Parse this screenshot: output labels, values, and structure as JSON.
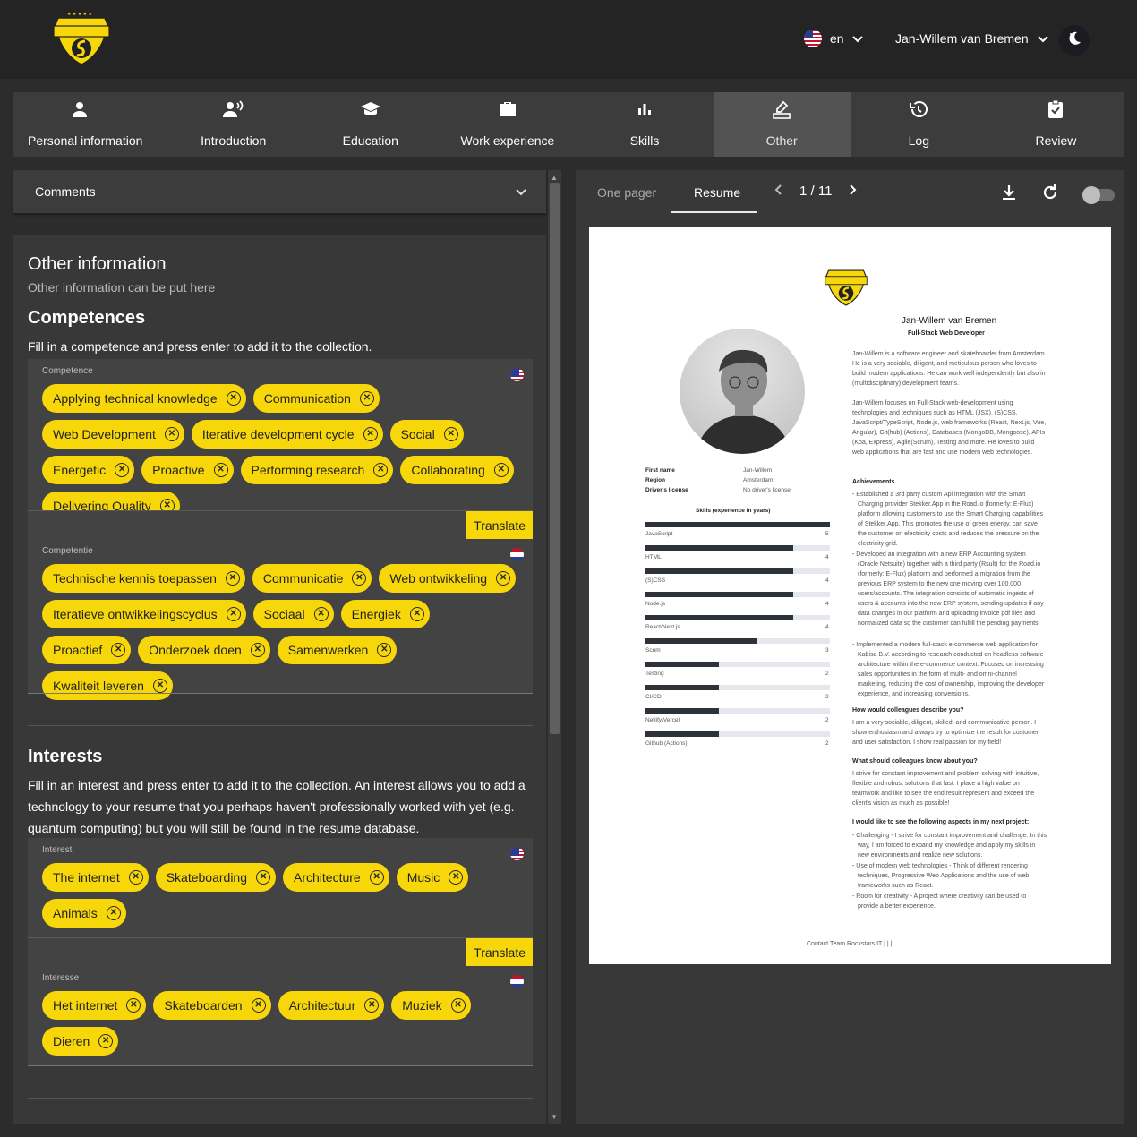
{
  "header": {
    "language": "en",
    "user_name": "Jan-Willem van Bremen"
  },
  "tabs": [
    {
      "label": "Personal information",
      "icon": "person-icon"
    },
    {
      "label": "Introduction",
      "icon": "speaker-icon"
    },
    {
      "label": "Education",
      "icon": "graduation-cap-icon"
    },
    {
      "label": "Work experience",
      "icon": "briefcase-icon"
    },
    {
      "label": "Skills",
      "icon": "bar-chart-icon"
    },
    {
      "label": "Other",
      "icon": "edit-box-icon"
    },
    {
      "label": "Log",
      "icon": "history-icon"
    },
    {
      "label": "Review",
      "icon": "clipboard-check-icon"
    }
  ],
  "active_tab": "Other",
  "comments": {
    "label": "Comments"
  },
  "other": {
    "title": "Other information",
    "subtitle": "Other information can be put here"
  },
  "competences": {
    "title": "Competences",
    "description": "Fill in a competence and press enter to add it to the collection.",
    "en_caption": "Competence",
    "en_items": [
      "Applying technical knowledge",
      "Communication",
      "Web Development",
      "Iterative development cycle",
      "Social",
      "Energetic",
      "Proactive",
      "Performing research",
      "Collaborating",
      "Delivering Quality"
    ],
    "translate_label": "Translate",
    "nl_caption": "Competentie",
    "nl_items": [
      "Technische kennis toepassen",
      "Communicatie",
      "Web ontwikkeling",
      "Iteratieve ontwikkelingscyclus",
      "Sociaal",
      "Energiek",
      "Proactief",
      "Onderzoek doen",
      "Samenwerken",
      "Kwaliteit leveren"
    ]
  },
  "interests": {
    "title": "Interests",
    "description": "Fill in an interest and press enter to add it to the collection. An interest allows you to add a technology to your resume that you perhaps haven't professionally worked with yet (e.g. quantum computing) but you will still be found in the resume database.",
    "en_caption": "Interest",
    "en_items": [
      "The internet",
      "Skateboarding",
      "Architecture",
      "Music",
      "Animals"
    ],
    "translate_label": "Translate",
    "nl_caption": "Interesse",
    "nl_items": [
      "Het internet",
      "Skateboarden",
      "Architectuur",
      "Muziek",
      "Dieren"
    ]
  },
  "preview": {
    "tab_one_pager": "One pager",
    "tab_resume": "Resume",
    "page_indicator": "1 / 11",
    "resume": {
      "name": "Jan-Willem van Bremen",
      "role": "Full-Stack Web Developer",
      "intro_1": "Jan-Willem is a software engineer and skateboarder from Amsterdam. He is a very sociable, diligent, and meticulous person who loves to build modern applications. He can work well independently but also in (multidisciplinary) development teams.",
      "intro_2": "Jan-Willem focuses on Full-Stack web-development using technologies and techniques such as HTML (JSX), (S)CSS, JavaScript/TypeScript, Node.js, web frameworks (React, Next.js, Vue, Angular), Git(hub) (Actions), Databases (MongoDB, Mongoose), APIs (Koa, Express), Agile(Scrum), Testing and more. He loves to build web applications that are fast and use modern web technologies.",
      "facts": [
        {
          "label": "First name",
          "value": "Jan-Willem"
        },
        {
          "label": "Region",
          "value": "Amsterdam"
        },
        {
          "label": "Driver's license",
          "value": "No driver's license"
        }
      ],
      "skills_title": "Skills (experience in years)",
      "skills": [
        {
          "name": "JavaScript",
          "years": 5
        },
        {
          "name": "HTML",
          "years": 4
        },
        {
          "name": "(S)CSS",
          "years": 4
        },
        {
          "name": "Node.js",
          "years": 4
        },
        {
          "name": "React/Next.js",
          "years": 4
        },
        {
          "name": "Scum",
          "years": 3
        },
        {
          "name": "Testing",
          "years": 2
        },
        {
          "name": "CI/CD",
          "years": 2
        },
        {
          "name": "Netlify/Vercel",
          "years": 2
        },
        {
          "name": "Github (Actions)",
          "years": 2
        }
      ],
      "achievements_title": "Achievements",
      "achievements": [
        "Established a 3rd party custom Api integration with the Smart Charging provider Stekker.App in the Road.io (formerly: E-Flux) platform allowing customers to use the Smart Charging capabilities of Stekker.App. This promotes the use of green energy, can save the customer on electricity costs and reduces the pressure on the electricity grid.",
        "Developed an integration with a new ERP Accounting system (Oracle Netsuite) together with a third party (Rsult) for the Road.io (formerly: E-Flux) platform and performed a migration from the previous ERP system to the new one moving over 100.000 users/accounts. The integration consists of automatic ingests of users & accounts into the new ERP system, sending updates if any data changes in our platform and uploading invoice pdf files and normalized data so the customer can fulfill the pending payments.",
        "Implemented a modern full-stack e-commerce web application for Kabisa B.V. according to research conducted on headless software architecture within the e-commerce context. Focused on increasing sales opportunities in the form of multi- and omni-channel marketing, reducing the cost of ownership, improving the developer experience, and increasing conversions."
      ],
      "q1_title": "How would colleagues describe you?",
      "q1_text": "I am a very sociable, diligent, skilled, and communicative person. I show enthusiasm and always try to optimize the result for customer and user satisfaction. I show real passion for my field!",
      "q2_title": "What should colleagues know about you?",
      "q2_text": "I strive for constant improvement and problem solving with intuitive, flexible and robust solutions that last. I place a high value on teamwork and like to see the end result represent and exceed the client's vision as much as possible!",
      "q3_title": "I would like to see the following aspects in my next project:",
      "q3_items": [
        "Challenging - I strive for constant improvement and challenge. In this way, I am forced to expand my knowledge and apply my skills in new environments and realize new solutions.",
        "Use of modern web technologies - Think of different rendering techniques, Progressive Web Applications and the use of web frameworks such as React.",
        "Room for creativity - A project where creativity can be used to provide a better experience."
      ],
      "footer": "Contact Team Rockstars IT | | |"
    }
  },
  "colors": {
    "accent": "#f7d70a",
    "background": "#2c2c2c",
    "panel": "#383838"
  }
}
